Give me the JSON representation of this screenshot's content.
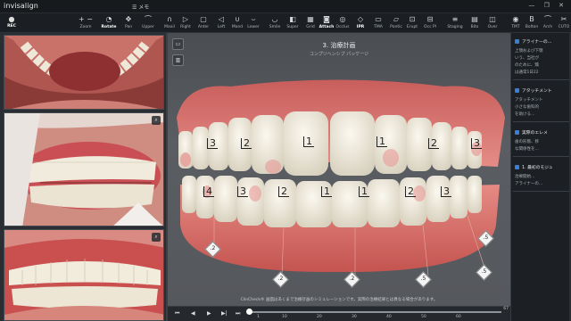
{
  "app": {
    "logo": "invisalign",
    "memo_label": "メモ",
    "window_controls": "— ❐ ✕"
  },
  "toolbar": {
    "user": {
      "icon": "person-icon",
      "label": "REC"
    },
    "tools": [
      {
        "id": "zoom",
        "icon": "zoom-icon",
        "glyph": "+ −",
        "label": "Zoom"
      },
      {
        "id": "rotate",
        "icon": "rotate-icon",
        "glyph": "◔",
        "label": "Rotate",
        "active": true
      },
      {
        "id": "pan",
        "icon": "pan-icon",
        "glyph": "✥",
        "label": "Pan"
      },
      {
        "id": "upper",
        "icon": "upper-jaw-icon",
        "glyph": "⌒",
        "label": "Upper"
      },
      {
        "id": "mand",
        "icon": "mandible-icon",
        "glyph": "∩",
        "label": "Maxil"
      },
      {
        "id": "right",
        "icon": "right-view-icon",
        "glyph": "▷",
        "label": "Right"
      },
      {
        "id": "anter",
        "icon": "anterior-view-icon",
        "glyph": "▢",
        "label": "Anter"
      },
      {
        "id": "left",
        "icon": "left-view-icon",
        "glyph": "◁",
        "label": "Left"
      },
      {
        "id": "mandib",
        "icon": "mandibular-icon",
        "glyph": "∪",
        "label": "Mand"
      },
      {
        "id": "lower",
        "icon": "lower-jaw-icon",
        "glyph": "⌣",
        "label": "Lower"
      },
      {
        "id": "smile",
        "icon": "smile-icon",
        "glyph": "◡",
        "label": "Smile"
      },
      {
        "id": "super",
        "icon": "superimpose-icon",
        "glyph": "◧",
        "label": "Super"
      },
      {
        "id": "grid",
        "icon": "grid-icon",
        "glyph": "▦",
        "label": "Grid"
      },
      {
        "id": "attach",
        "icon": "attachment-icon",
        "glyph": "◙",
        "label": "Attach",
        "active": true
      },
      {
        "id": "occlus",
        "icon": "occlusion-icon",
        "glyph": "◎",
        "label": "Occlus"
      },
      {
        "id": "ipr",
        "icon": "ipr-icon",
        "glyph": "◇",
        "label": "IPR",
        "active": true
      },
      {
        "id": "tma",
        "icon": "tma-icon",
        "glyph": "▭",
        "label": "TMA"
      },
      {
        "id": "pontic",
        "icon": "pontic-icon",
        "glyph": "▱",
        "label": "Pontic"
      },
      {
        "id": "erupt",
        "icon": "eruption-icon",
        "glyph": "⊡",
        "label": "Erupt"
      },
      {
        "id": "occpl",
        "icon": "occlusal-plane-icon",
        "glyph": "⊟",
        "label": "Occ Pl"
      },
      {
        "id": "staging",
        "icon": "staging-icon",
        "glyph": "≡",
        "label": "Staging"
      },
      {
        "id": "bitto",
        "icon": "bite-icon",
        "glyph": "▤",
        "label": "Bito"
      },
      {
        "id": "over",
        "icon": "overlay-icon",
        "glyph": "◫",
        "label": "Over"
      },
      {
        "id": "tmt",
        "icon": "tmt-icon",
        "glyph": "◉",
        "label": "TMT"
      },
      {
        "id": "bolton",
        "icon": "bolton-icon",
        "glyph": "B",
        "label": "Bolton"
      },
      {
        "id": "arch",
        "icon": "arch-icon",
        "glyph": "⌒",
        "label": "Arch"
      },
      {
        "id": "cut",
        "icon": "cut-icon",
        "glyph": "✂",
        "label": "CUTO"
      }
    ]
  },
  "viewer": {
    "stage_title": "3. 治療計画",
    "stage_subtitle": "コンプリヘンシブ パッケージ",
    "footnote": "ClinCheck® 画面はあくまで治療計画のシミュレーションです。実際の治療結果とは異なる場合があります。",
    "upper_labels": [
      "3",
      "2",
      "1",
      "1",
      "2",
      "3"
    ],
    "lower_labels": [
      "4",
      "3",
      "2",
      "1",
      "1",
      "2",
      "3"
    ],
    "ipr_values": [
      ".2",
      ".2",
      ".2",
      ".5",
      ".5",
      ".5"
    ]
  },
  "timeline": {
    "ticks": [
      "1",
      "10",
      "20",
      "30",
      "40",
      "50",
      "60"
    ],
    "end_value": "67"
  },
  "right_panel": {
    "sections": [
      {
        "head": "アライナーの...",
        "lines": [
          "上顎および下顎",
          "いう、当社が",
          "のために、矯",
          "は通常1日22"
        ]
      },
      {
        "head": "アタッチメント",
        "lines": [
          "アタッチメント",
          "小さな歯科的",
          "を助ける…"
        ]
      },
      {
        "head": "実際のエレメ",
        "lines": [
          "歯の形態、移",
          "な関係性を…"
        ]
      },
      {
        "head": "1. 最初のモジュ",
        "lines": [
          "治療開始…",
          "アライナーの…"
        ]
      }
    ]
  },
  "colors": {
    "accent": "#3b7fd1",
    "gum": "#d9706e",
    "tooth": "#f1ece0"
  }
}
